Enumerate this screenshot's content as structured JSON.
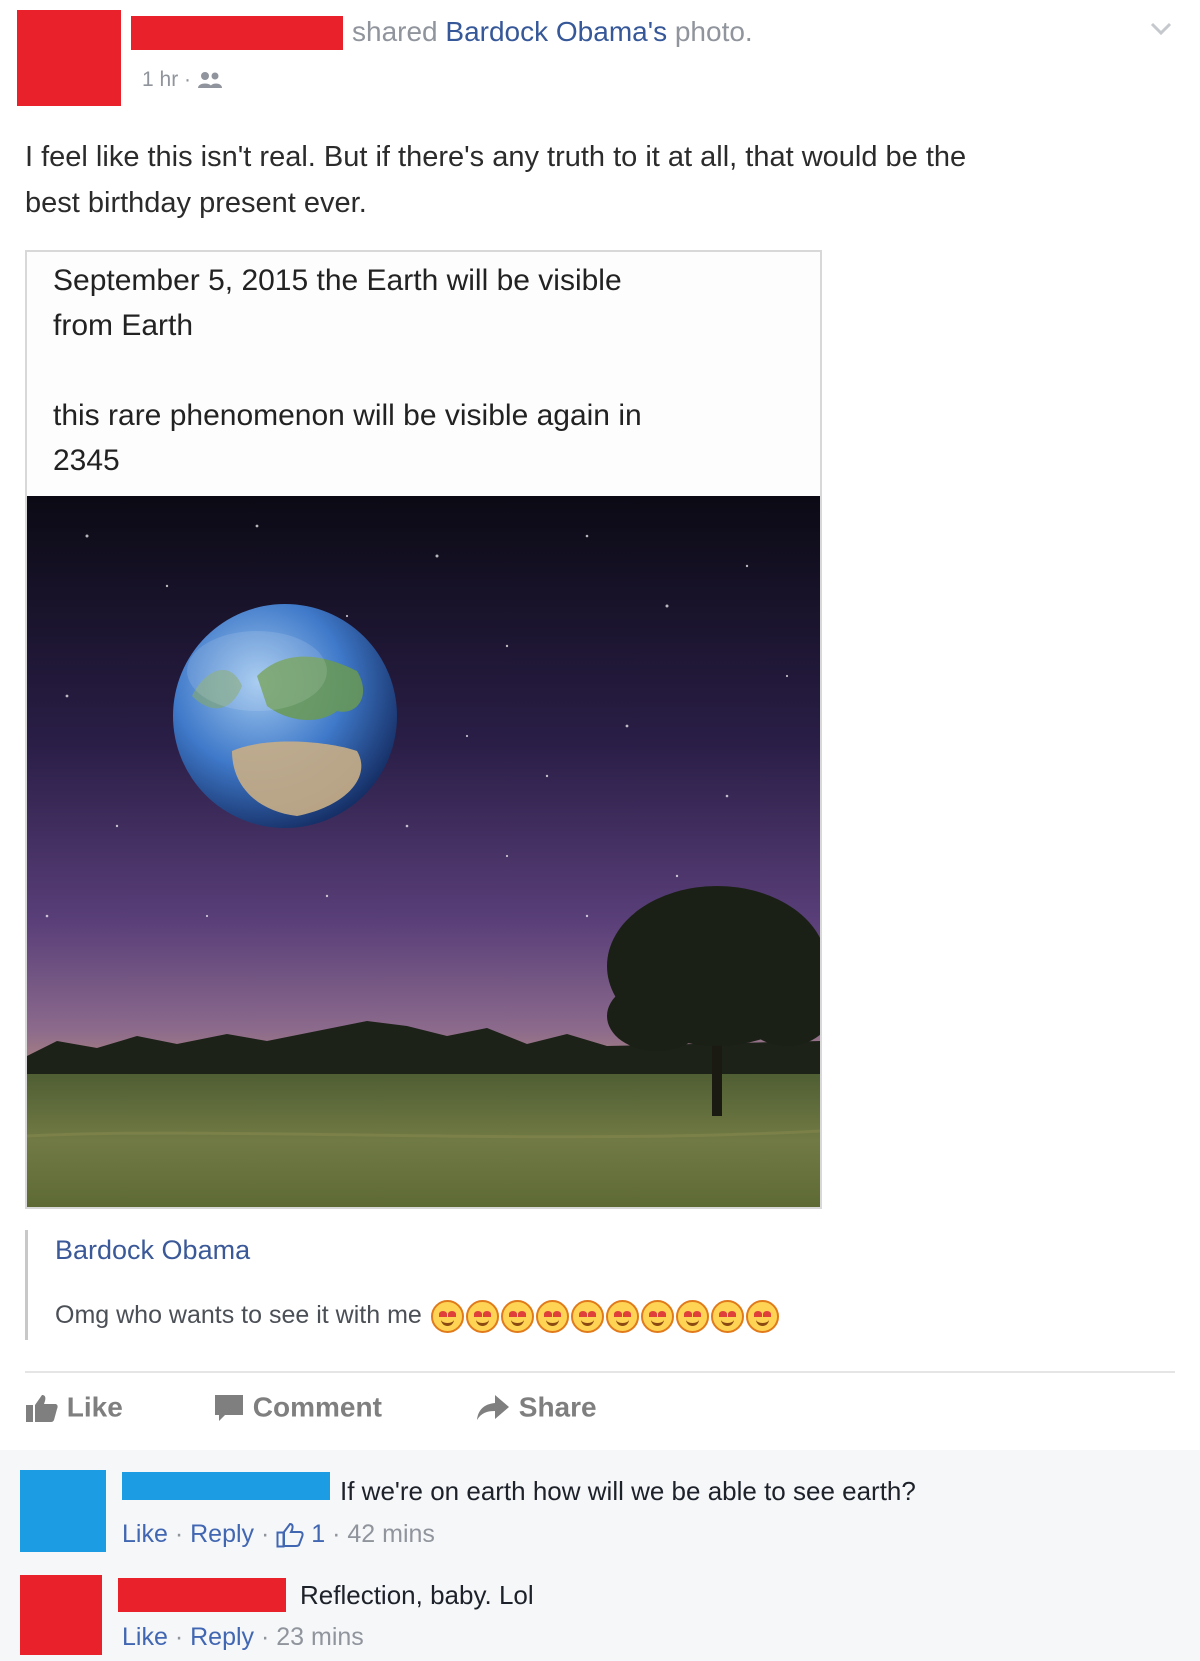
{
  "post": {
    "shared_prefix": "shared ",
    "shared_name": "Bardock Obama's",
    "shared_suffix": " photo.",
    "time": "1 hr",
    "text_line1": "I feel like this isn't real. But if there's any truth to it at all, that would be the",
    "text_line2": "best birthday present ever."
  },
  "card": {
    "line1": "September 5, 2015 the Earth will be visible",
    "line2": "from Earth",
    "line3": "this rare phenomenon will be visible again in",
    "line4": "2345"
  },
  "attribution": {
    "name": "Bardock Obama",
    "text": "Omg who wants to see it with me",
    "emoji_count": 10
  },
  "actions": {
    "like": "Like",
    "comment": "Comment",
    "share": "Share"
  },
  "comments": [
    {
      "text": "If we're on earth how will we be able to see earth?",
      "like": "Like",
      "reply": "Reply",
      "likes": "1",
      "time": "42 mins",
      "color": "#1b9ce3"
    },
    {
      "text": "Reflection, baby. Lol",
      "like": "Like",
      "reply": "Reply",
      "time": "23 mins",
      "color": "#e8212b"
    }
  ],
  "colors": {
    "redaction_red": "#e8212b",
    "redaction_blue": "#1b9ce3",
    "link": "#3b5998"
  }
}
